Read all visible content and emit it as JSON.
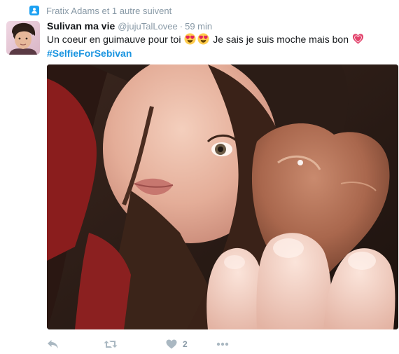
{
  "context": {
    "text": "Fratix Adams et 1 autre suivent",
    "icon": "follow-person-icon"
  },
  "tweet": {
    "author_name": "Sulivan ma vie",
    "handle": "@jujuTalLovee",
    "separator": "·",
    "time": "59 min",
    "text_part1": "Un coeur en guimauve pour toi",
    "text_part2": "Je sais je suis moche mais bon",
    "hashtag": "#SelfieForSebivan",
    "emojis": [
      "heart-eyes-icon",
      "heart-eyes-icon",
      "heart-icon"
    ],
    "like_count": "2"
  },
  "colors": {
    "accent": "#1da1f2",
    "hashtag": "#1b95e0",
    "muted": "#8899a6",
    "action_icons": "#aab8c2"
  }
}
